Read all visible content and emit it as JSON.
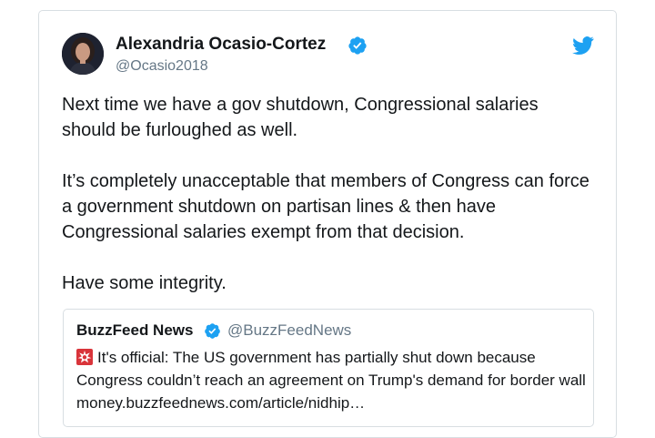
{
  "tweet": {
    "author_name": "Alexandria Ocasio-Cortez",
    "author_handle": "@Ocasio2018",
    "paragraphs": [
      "Next time we have a gov shutdown, Congressional salaries should be furloughed as well.",
      "It’s completely unacceptable that members of Congress can force a government shutdown on partisan lines & then have Congressional salaries exempt from that decision.",
      "Have some integrity."
    ]
  },
  "quote": {
    "author_name": "BuzzFeed News",
    "author_handle": "@BuzzFeedNews",
    "text": "It's official: The US government has partially shut down because Congress couldn’t reach an agreement on Trump's demand for border wall money.buzzfeednews.com/article/nidhip…"
  },
  "icons": {
    "verified": "verified-badge-icon",
    "twitter": "twitter-bird-icon",
    "siren": "rotating-light-emoji-icon"
  },
  "colors": {
    "twitter_blue": "#1da1f2",
    "text": "#14171a",
    "muted": "#657786",
    "border": "#d8dee2",
    "siren_red": "#d9343a"
  }
}
